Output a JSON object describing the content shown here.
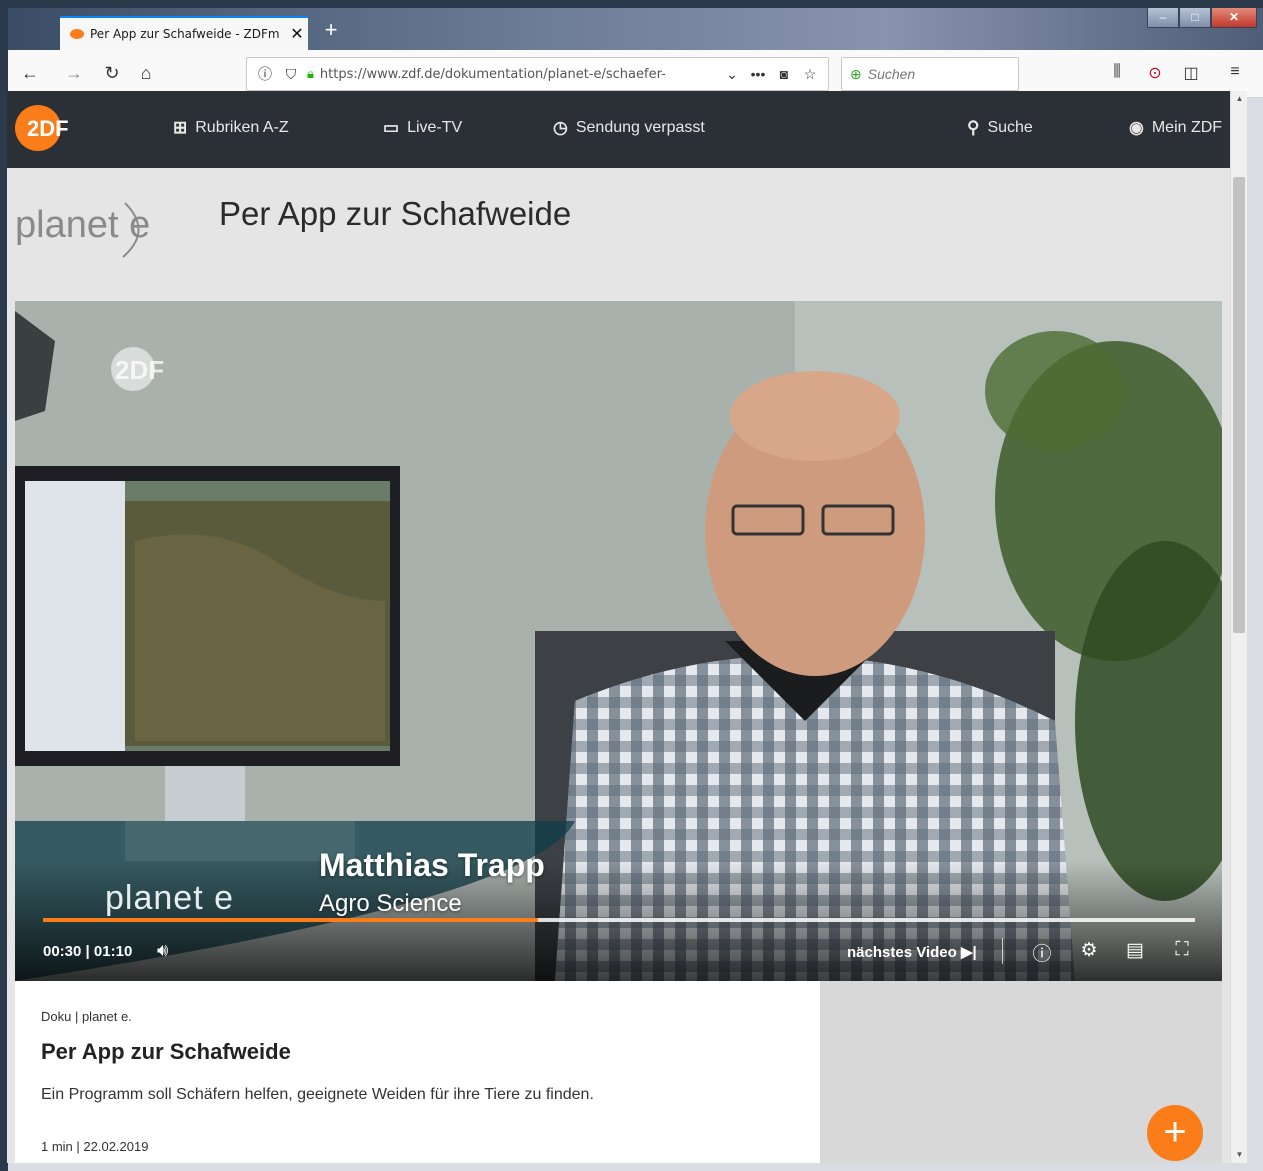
{
  "browser": {
    "tab_title": "Per App zur Schafweide - ZDFm",
    "tab_close": "✕",
    "new_tab": "+",
    "url": "https://www.zdf.de/dokumentation/planet-e/schaefer-",
    "search_placeholder": "Suchen",
    "window_buttons": {
      "minimize": "–",
      "maximize": "□",
      "close": "✕"
    }
  },
  "zdf_nav": {
    "logo_text": "2DF",
    "items": [
      {
        "label": "Rubriken A-Z",
        "icon": "grid-icon"
      },
      {
        "label": "Live-TV",
        "icon": "tv-icon"
      },
      {
        "label": "Sendung verpasst",
        "icon": "clock-icon"
      },
      {
        "label": "Suche",
        "icon": "search-icon"
      },
      {
        "label": "Mein ZDF",
        "icon": "user-icon"
      }
    ]
  },
  "header": {
    "show_logo": "planet e",
    "title": "Per App zur Schafweide"
  },
  "video": {
    "watermark": "2DF",
    "lower_third_name": "Matthias Trapp",
    "lower_third_role": "Agro Science",
    "planet_logo": "planet e",
    "current_time": "00:30",
    "duration": "01:10",
    "time_separator": "|",
    "progress_fraction": 0.43,
    "next_video_label": "nächstes Video"
  },
  "info": {
    "category": "Doku | planet e.",
    "title": "Per App zur Schafweide",
    "description": "Ein Programm soll Schäfern helfen, geeignete Weiden für ihre Tiere zu finden.",
    "meta": "1 min | 22.02.2019"
  },
  "colors": {
    "accent": "#fa7d19",
    "nav_bg": "#2b3037"
  }
}
